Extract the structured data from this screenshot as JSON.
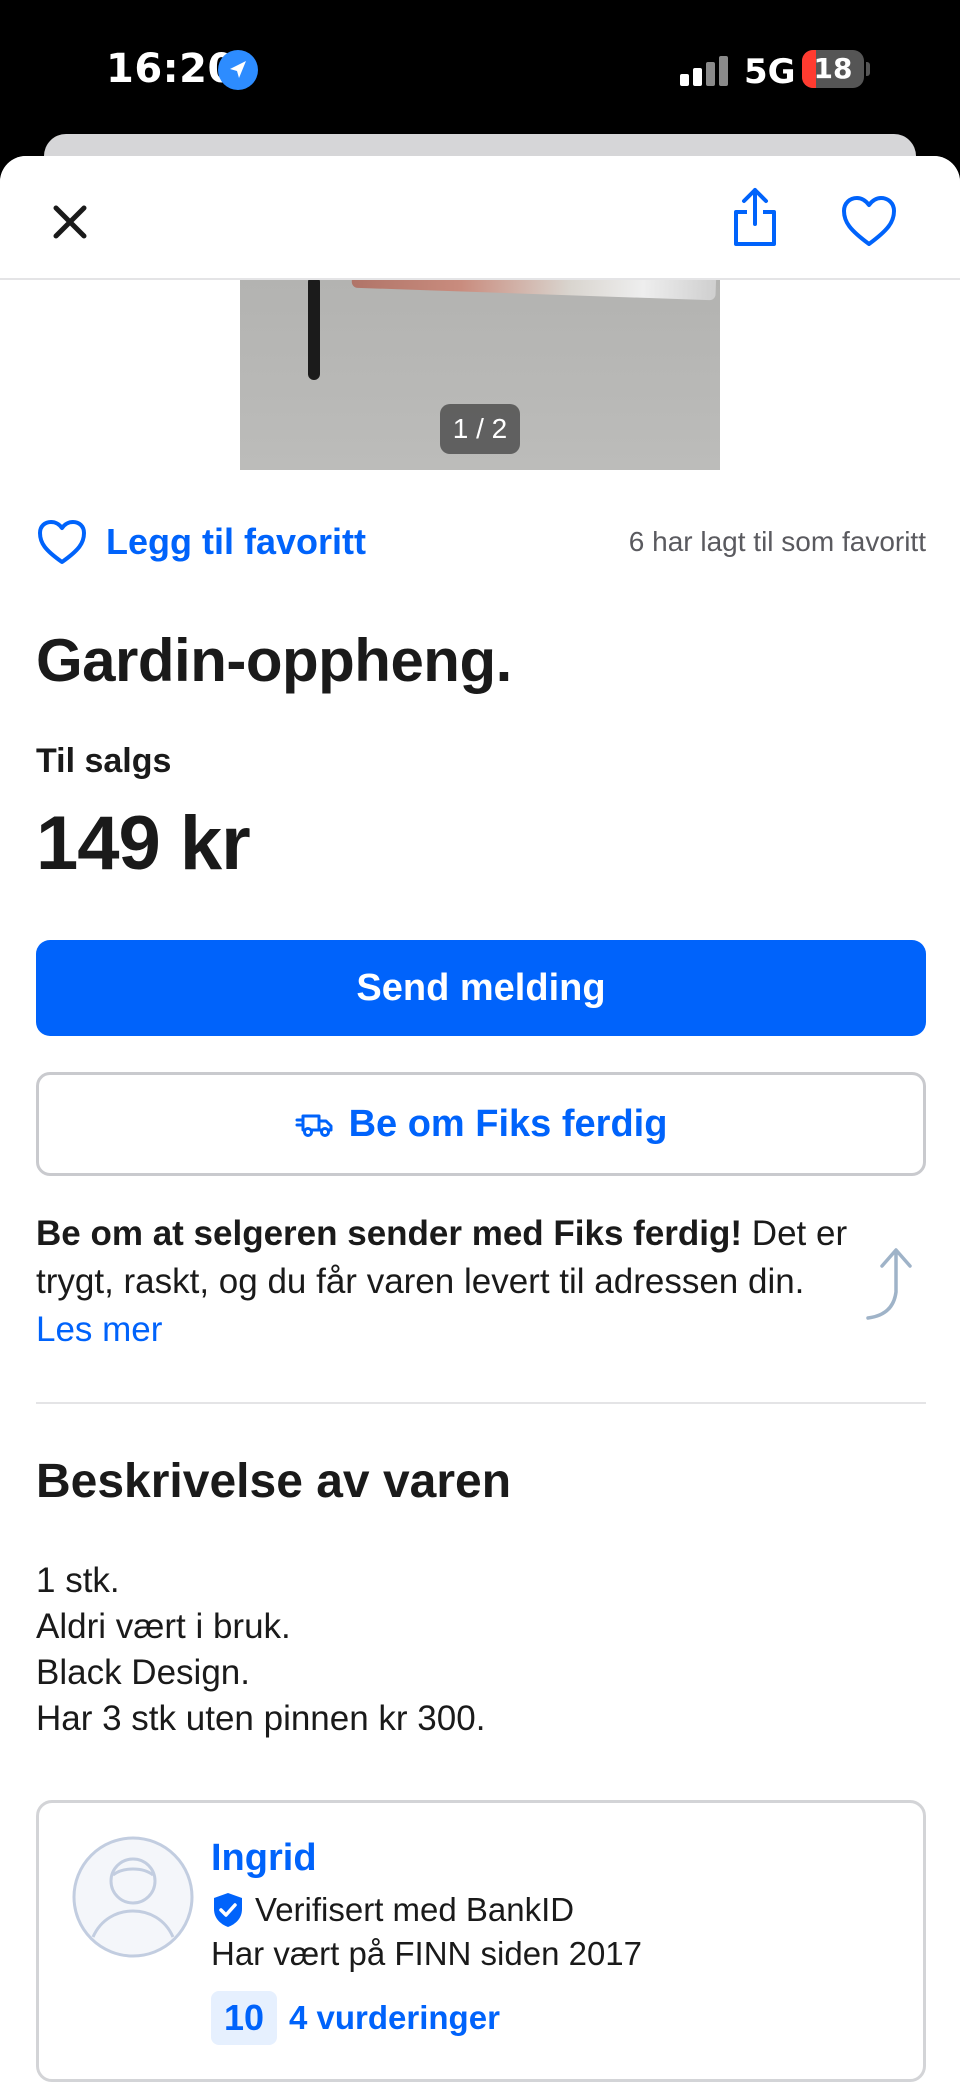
{
  "status_bar": {
    "time": "16:20",
    "network": "5G",
    "battery": "18"
  },
  "gallery": {
    "counter": "1 / 2"
  },
  "favorite": {
    "label": "Legg til favoritt",
    "count_text": "6 har lagt til som favoritt"
  },
  "listing": {
    "title": "Gardin-oppheng.",
    "sale_type": "Til salgs",
    "price": "149 kr"
  },
  "actions": {
    "send_label": "Send melding",
    "fiks_label": "Be om Fiks ferdig"
  },
  "fiks_info": {
    "bold": "Be om at selgeren sender med Fiks ferdig!",
    "text": " Det er trygt, raskt, og du får varen levert til adressen din. ",
    "link": "Les mer"
  },
  "description": {
    "heading": "Beskrivelse av varen",
    "lines": [
      "1 stk.",
      "Aldri vært i bruk.",
      "Black Design.",
      "Har 3 stk uten pinnen kr 300."
    ]
  },
  "seller": {
    "name": "Ingrid",
    "verified": "Verifisert med BankID",
    "since": "Har vært på FINN siden 2017",
    "score": "10",
    "reviews": "4 vurderinger"
  },
  "colors": {
    "accent": "#0063fb",
    "text": "#1a1a1a",
    "muted": "#5a5a5f"
  }
}
